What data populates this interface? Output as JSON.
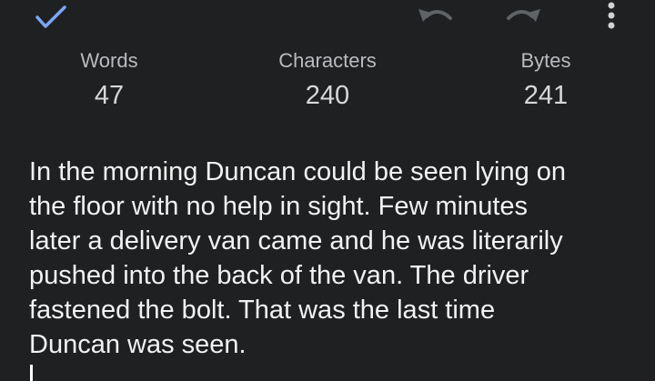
{
  "toolbar": {
    "done_icon": "checkmark-icon",
    "undo_icon": "undo-icon",
    "redo_icon": "redo-icon",
    "more_icon": "more-vertical-icon",
    "accent_color": "#7aa7f5",
    "disabled_color": "#5f6266"
  },
  "stats": {
    "words_label": "Words",
    "words_value": "47",
    "characters_label": "Characters",
    "characters_value": "240",
    "bytes_label": "Bytes",
    "bytes_value": "241"
  },
  "editor": {
    "text": "In the morning Duncan could be seen lying on\nthe floor with no help in sight. Few minutes\nlater a delivery van came and he was literarily\npushed into the back of the van. The driver\nfastened the bolt. That was the last time\nDuncan was seen."
  }
}
